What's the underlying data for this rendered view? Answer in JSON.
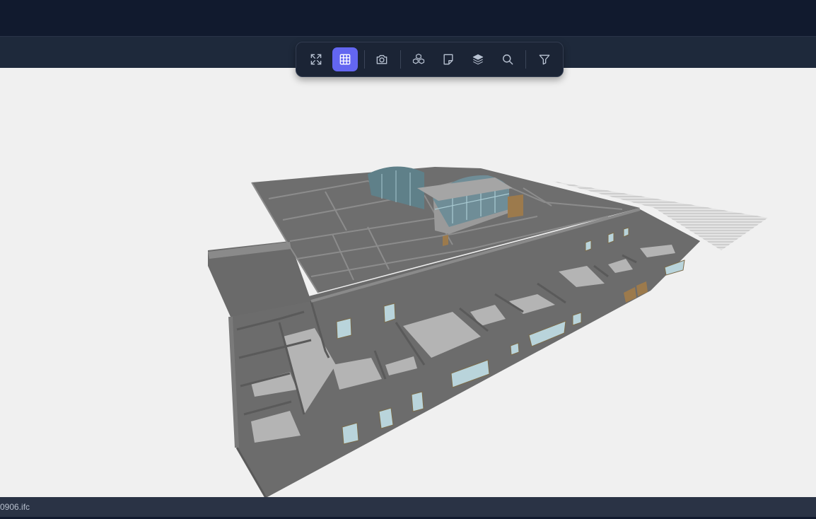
{
  "toolbar": {
    "buttons": [
      {
        "name": "fit-view",
        "icon": "expand-icon",
        "active": false
      },
      {
        "name": "section",
        "icon": "grid-icon",
        "active": true
      },
      {
        "name": "screenshot",
        "icon": "camera-icon",
        "active": false
      },
      {
        "name": "models",
        "icon": "boxes-icon",
        "active": false
      },
      {
        "name": "notes",
        "icon": "sticky-note-icon",
        "active": false
      },
      {
        "name": "layers",
        "icon": "layers-icon",
        "active": false
      },
      {
        "name": "search",
        "icon": "search-icon",
        "active": false
      },
      {
        "name": "filter",
        "icon": "filter-icon",
        "active": false
      }
    ],
    "accent": "#6366f1"
  },
  "status": {
    "filename": "0906.ifc"
  }
}
